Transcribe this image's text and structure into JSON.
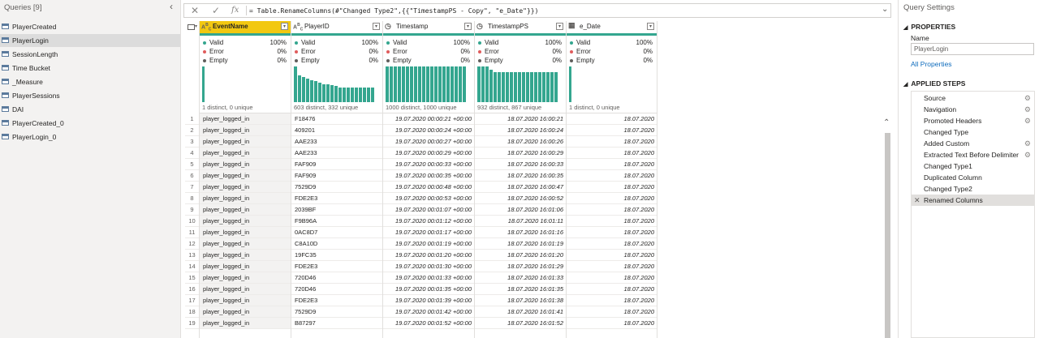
{
  "queries_pane": {
    "header": "Queries [9]",
    "items": [
      {
        "label": "PlayerCreated",
        "selected": false
      },
      {
        "label": "PlayerLogin",
        "selected": true
      },
      {
        "label": "SessionLength",
        "selected": false
      },
      {
        "label": "Time Bucket",
        "selected": false
      },
      {
        "label": "_Measure",
        "selected": false
      },
      {
        "label": "PlayerSessions",
        "selected": false
      },
      {
        "label": "DAI",
        "selected": false
      },
      {
        "label": "PlayerCreated_0",
        "selected": false
      },
      {
        "label": "PlayerLogin_0",
        "selected": false
      }
    ]
  },
  "formula_bar": {
    "cancel_icon": "close-icon",
    "commit_icon": "check-icon",
    "fx_label": "fx",
    "formula": "= Table.RenameColumns(#\"Changed Type2\",{{\"TimestampPS - Copy\", \"e_Date\"}})"
  },
  "grid": {
    "colors": {
      "quality_bar": "#34a68f",
      "selected_header": "#f2c811",
      "valid": "#34a68f",
      "error": "#e05c5c",
      "empty": "#605e5c"
    },
    "columns": [
      {
        "name": "EventName",
        "type_icon": "ABC",
        "selected": true,
        "align": "l",
        "quality": {
          "valid": "100%",
          "error": "0%",
          "empty": "0%"
        },
        "distinct": "1 distinct, 0 unique",
        "dist_bars": [
          1
        ]
      },
      {
        "name": "PlayerID",
        "type_icon": "ABC",
        "selected": false,
        "align": "l",
        "quality": {
          "valid": "100%",
          "error": "0%",
          "empty": "0%"
        },
        "distinct": "603 distinct, 332 unique",
        "dist_bars": [
          1,
          0.75,
          0.7,
          0.65,
          0.62,
          0.6,
          0.55,
          0.5,
          0.5,
          0.48,
          0.45,
          0.42,
          0.42,
          0.42,
          0.42,
          0.42,
          0.42,
          0.42,
          0.42,
          0.42
        ]
      },
      {
        "name": "Timestamp",
        "type_icon": "clock",
        "selected": false,
        "align": "r",
        "quality": {
          "valid": "100%",
          "error": "0%",
          "empty": "0%"
        },
        "distinct": "1000 distinct, 1000 unique",
        "dist_bars": [
          1,
          1,
          1,
          1,
          1,
          1,
          1,
          1,
          1,
          1,
          1,
          1,
          1,
          1,
          1,
          1,
          1,
          1,
          1,
          1
        ]
      },
      {
        "name": "TimestampPS",
        "type_icon": "clock",
        "selected": false,
        "align": "r",
        "quality": {
          "valid": "100%",
          "error": "0%",
          "empty": "0%"
        },
        "distinct": "932 distinct, 867 unique",
        "dist_bars": [
          1,
          1,
          1,
          0.9,
          0.85,
          0.85,
          0.85,
          0.85,
          0.85,
          0.85,
          0.85,
          0.85,
          0.85,
          0.85,
          0.85,
          0.85,
          0.85,
          0.85,
          0.85,
          0.85
        ]
      },
      {
        "name": "e_Date",
        "type_icon": "calendar",
        "selected": false,
        "align": "r",
        "quality": {
          "valid": "100%",
          "error": "0%",
          "empty": "0%"
        },
        "distinct": "1 distinct, 0 unique",
        "dist_bars": [
          1
        ]
      }
    ],
    "quality_labels": {
      "valid": "Valid",
      "error": "Error",
      "empty": "Empty"
    },
    "rows": [
      [
        "1",
        "player_logged_in",
        "F18476",
        "19.07.2020 00:00:21 +00:00",
        "18.07.2020 16:00:21",
        "18.07.2020"
      ],
      [
        "2",
        "player_logged_in",
        "409201",
        "19.07.2020 00:00:24 +00:00",
        "18.07.2020 16:00:24",
        "18.07.2020"
      ],
      [
        "3",
        "player_logged_in",
        "AAE233",
        "19.07.2020 00:00:27 +00:00",
        "18.07.2020 16:00:26",
        "18.07.2020"
      ],
      [
        "4",
        "player_logged_in",
        "AAE233",
        "19.07.2020 00:00:29 +00:00",
        "18.07.2020 16:00:29",
        "18.07.2020"
      ],
      [
        "5",
        "player_logged_in",
        "FAF909",
        "19.07.2020 00:00:33 +00:00",
        "18.07.2020 16:00:33",
        "18.07.2020"
      ],
      [
        "6",
        "player_logged_in",
        "FAF909",
        "19.07.2020 00:00:35 +00:00",
        "18.07.2020 16:00:35",
        "18.07.2020"
      ],
      [
        "7",
        "player_logged_in",
        "7529D9",
        "19.07.2020 00:00:48 +00:00",
        "18.07.2020 16:00:47",
        "18.07.2020"
      ],
      [
        "8",
        "player_logged_in",
        "FDE2E3",
        "19.07.2020 00:00:53 +00:00",
        "18.07.2020 16:00:52",
        "18.07.2020"
      ],
      [
        "9",
        "player_logged_in",
        "2039BF",
        "19.07.2020 00:01:07 +00:00",
        "18.07.2020 16:01:06",
        "18.07.2020"
      ],
      [
        "10",
        "player_logged_in",
        "F9B96A",
        "19.07.2020 00:01:12 +00:00",
        "18.07.2020 16:01:11",
        "18.07.2020"
      ],
      [
        "11",
        "player_logged_in",
        "0AC8D7",
        "19.07.2020 00:01:17 +00:00",
        "18.07.2020 16:01:16",
        "18.07.2020"
      ],
      [
        "12",
        "player_logged_in",
        "C8A10D",
        "19.07.2020 00:01:19 +00:00",
        "18.07.2020 16:01:19",
        "18.07.2020"
      ],
      [
        "13",
        "player_logged_in",
        "19FC35",
        "19.07.2020 00:01:20 +00:00",
        "18.07.2020 16:01:20",
        "18.07.2020"
      ],
      [
        "14",
        "player_logged_in",
        "FDE2E3",
        "19.07.2020 00:01:30 +00:00",
        "18.07.2020 16:01:29",
        "18.07.2020"
      ],
      [
        "15",
        "player_logged_in",
        "720D46",
        "19.07.2020 00:01:33 +00:00",
        "18.07.2020 16:01:33",
        "18.07.2020"
      ],
      [
        "16",
        "player_logged_in",
        "720D46",
        "19.07.2020 00:01:35 +00:00",
        "18.07.2020 16:01:35",
        "18.07.2020"
      ],
      [
        "17",
        "player_logged_in",
        "FDE2E3",
        "19.07.2020 00:01:39 +00:00",
        "18.07.2020 16:01:38",
        "18.07.2020"
      ],
      [
        "18",
        "player_logged_in",
        "7529D9",
        "19.07.2020 00:01:42 +00:00",
        "18.07.2020 16:01:41",
        "18.07.2020"
      ],
      [
        "19",
        "player_logged_in",
        "B87297",
        "19.07.2020 00:01:52 +00:00",
        "18.07.2020 16:01:52",
        "18.07.2020"
      ]
    ]
  },
  "query_settings": {
    "title": "Query Settings",
    "properties_header": "PROPERTIES",
    "name_label": "Name",
    "name_value": "PlayerLogin",
    "all_properties": "All Properties",
    "steps_header": "APPLIED STEPS",
    "steps": [
      {
        "label": "Source",
        "gear": true,
        "selected": false
      },
      {
        "label": "Navigation",
        "gear": true,
        "selected": false
      },
      {
        "label": "Promoted Headers",
        "gear": true,
        "selected": false
      },
      {
        "label": "Changed Type",
        "gear": false,
        "selected": false
      },
      {
        "label": "Added Custom",
        "gear": true,
        "selected": false
      },
      {
        "label": "Extracted Text Before Delimiter",
        "gear": true,
        "selected": false
      },
      {
        "label": "Changed Type1",
        "gear": false,
        "selected": false
      },
      {
        "label": "Duplicated Column",
        "gear": false,
        "selected": false
      },
      {
        "label": "Changed Type2",
        "gear": false,
        "selected": false
      },
      {
        "label": "Renamed Columns",
        "gear": false,
        "selected": true
      }
    ]
  }
}
